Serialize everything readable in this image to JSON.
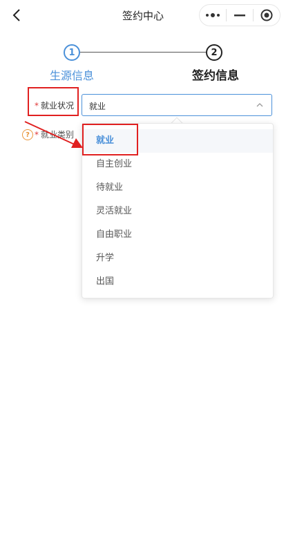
{
  "navbar": {
    "title": "签约中心"
  },
  "steps": [
    {
      "number": "1",
      "label": "生源信息"
    },
    {
      "number": "2",
      "label": "签约信息"
    }
  ],
  "form": {
    "employment_status": {
      "required_mark": "*",
      "label": "就业状况",
      "value": "就业"
    },
    "employment_type": {
      "required_mark": "*",
      "label": "就业类别",
      "help_icon_text": "?"
    }
  },
  "dropdown": {
    "options": [
      "就业",
      "自主创业",
      "待就业",
      "灵活就业",
      "自由职业",
      "升学",
      "出国"
    ],
    "selected_index": 0
  },
  "colors": {
    "accent": "#4a90d9",
    "required": "#e03a3a",
    "annotation": "#e02020",
    "help": "#e8953a"
  }
}
